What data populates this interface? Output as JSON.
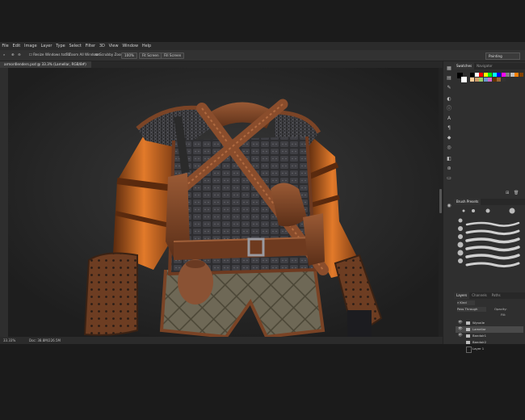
{
  "menu": [
    "File",
    "Edit",
    "Image",
    "Layer",
    "Type",
    "Select",
    "Filter",
    "3D",
    "View",
    "Window",
    "Help"
  ],
  "options_bar": {
    "resize_windows": "Resize Windows to Fit",
    "zoom_all": "Zoom All Windows",
    "scrubby_zoom": "Scrubby Zoom",
    "zoom_pct": "100%",
    "fit_screen": "Fit Screen",
    "fill_screen": "Fill Screen",
    "workspace": "Painting"
  },
  "document": {
    "tab_title": "armor4lenders.psd @ 33.3% (Lamellar, RGB/8#)",
    "zoom_status": "33.33%",
    "doc_status": "Doc: 38.8M/226.5M"
  },
  "panels": {
    "swatches_tab": "Swatches",
    "navigator_tab": "Navigator",
    "brush_presets_tab": "Brush Presets",
    "layers_tab": "Layers",
    "channels_tab": "Channels",
    "paths_tab": "Paths",
    "kind_label": "Kind",
    "blend_mode": "Pass Through",
    "opacity_label": "Opacity:",
    "fill_label": "Fill:"
  },
  "layers": [
    {
      "name": "Wyvalle",
      "type": "folder",
      "visible": true
    },
    {
      "name": "Lamellar",
      "type": "folder",
      "visible": true
    },
    {
      "name": "Bandoir1",
      "type": "folder",
      "visible": true
    },
    {
      "name": "Bandoir2",
      "type": "folder",
      "visible": false
    },
    {
      "name": "Layer 1",
      "type": "layer",
      "visible": false
    }
  ],
  "swatch_colors": [
    "#000000",
    "#ffffff",
    "#ff0000",
    "#ffff00",
    "#00ff00",
    "#00ffff",
    "#0000ff",
    "#ff00ff",
    "#808080",
    "#c0c0c0",
    "#ff8000",
    "#804000",
    "#ffcc99",
    "#cc9966",
    "#99cc66",
    "#6699cc",
    "#cc66cc",
    "#663300",
    "#996633",
    "#333333"
  ],
  "icons": [
    "move-icon",
    "marquee-icon",
    "lasso-icon",
    "crop-icon",
    "brush-icon",
    "eraser-icon",
    "text-icon",
    "hand-icon",
    "zoom-icon"
  ]
}
